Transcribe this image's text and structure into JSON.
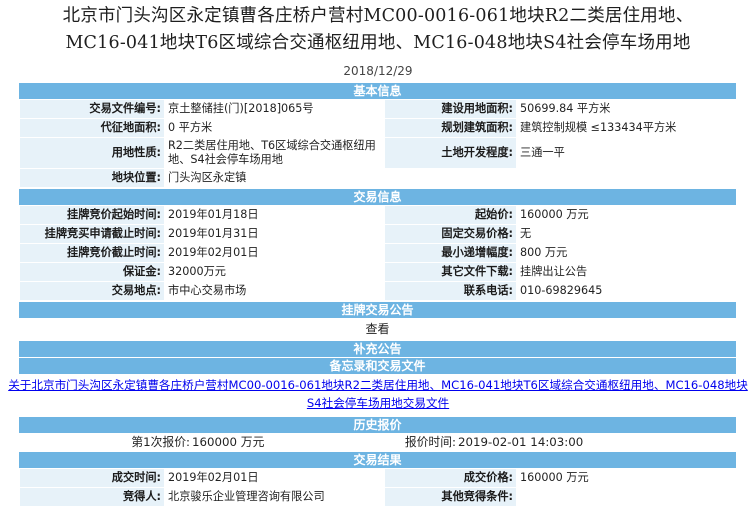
{
  "title_line1": "北京市门头沟区永定镇曹各庄桥户营村MC00-0016-061地块R2二类居住用地、",
  "title_line2": "MC16-041地块T6区域综合交通枢纽用地、MC16-048地块S4社会停车场用地",
  "date": "2018/12/29",
  "basic": {
    "header": "基本信息",
    "doc_label": "交易文件编号:",
    "doc_value": "京土整储挂(门)[2018]065号",
    "build_area_label": "建设用地面积:",
    "build_area_value": "50699.84 平方米",
    "exp_area_label": "代征地面积:",
    "exp_area_value": "0 平方米",
    "plan_area_label": "规划建筑面积:",
    "plan_area_value": "建筑控制规模 ≤133434平方米",
    "usage_label": "用地性质:",
    "usage_value": "R2二类居住用地、T6区域综合交通枢纽用地、S4社会停车场用地",
    "dev_label": "土地开发程度:",
    "dev_value": "三通一平",
    "loc_label": "地块位置:",
    "loc_value": "门头沟区永定镇"
  },
  "trade": {
    "header": "交易信息",
    "start_time_label": "挂牌竞价起始时间:",
    "start_time_value": "2019年01月18日",
    "start_price_label": "起始价:",
    "start_price_value": "160000 万元",
    "deadline_label": "挂牌竞买申请截止时间:",
    "deadline_value": "2019年01月31日",
    "fixed_price_label": "固定交易价格:",
    "fixed_price_value": "无",
    "end_time_label": "挂牌竞价截止时间:",
    "end_time_value": "2019年02月01日",
    "min_inc_label": "最小递增幅度:",
    "min_inc_value": "800 万元",
    "deposit_label": "保证金:",
    "deposit_value": "32000万元",
    "other_docs_label": "其它文件下载:",
    "other_docs_value": "挂牌出让公告",
    "place_label": "交易地点:",
    "place_value": "市中心交易市场",
    "phone_label": "联系电话:",
    "phone_value": "010-69829645"
  },
  "notice": {
    "header": "挂牌交易公告",
    "view_link": "查看"
  },
  "supplement": {
    "header": "补充公告",
    "subheader": "备忘录和交易文件",
    "link_text": "关于北京市门头沟区永定镇曹各庄桥户营村MC00-0016-061地块R2二类居住用地、MC16-041地块T6区域综合交通枢纽用地、MC16-048地块S4社会停车场用地交易文件"
  },
  "history": {
    "header": "历史报价",
    "bid_label": "第1次报价:",
    "bid_value": "160000 万元",
    "bid_time_label": "报价时间:",
    "bid_time_value": "2019-02-01 14:03:00"
  },
  "result": {
    "header": "交易结果",
    "deal_time_label": "成交时间:",
    "deal_time_value": "2019年02月01日",
    "deal_price_label": "成交价格:",
    "deal_price_value": "160000 万元",
    "winner_label": "竞得人:",
    "winner_value": "北京骏乐企业管理咨询有限公司",
    "other_cond_label": "其他竞得条件:",
    "other_cond_value": ""
  },
  "colors": {
    "header_bar": "#6db4e2",
    "label_bg": "#e7f2f9",
    "link": "#0000ee"
  }
}
